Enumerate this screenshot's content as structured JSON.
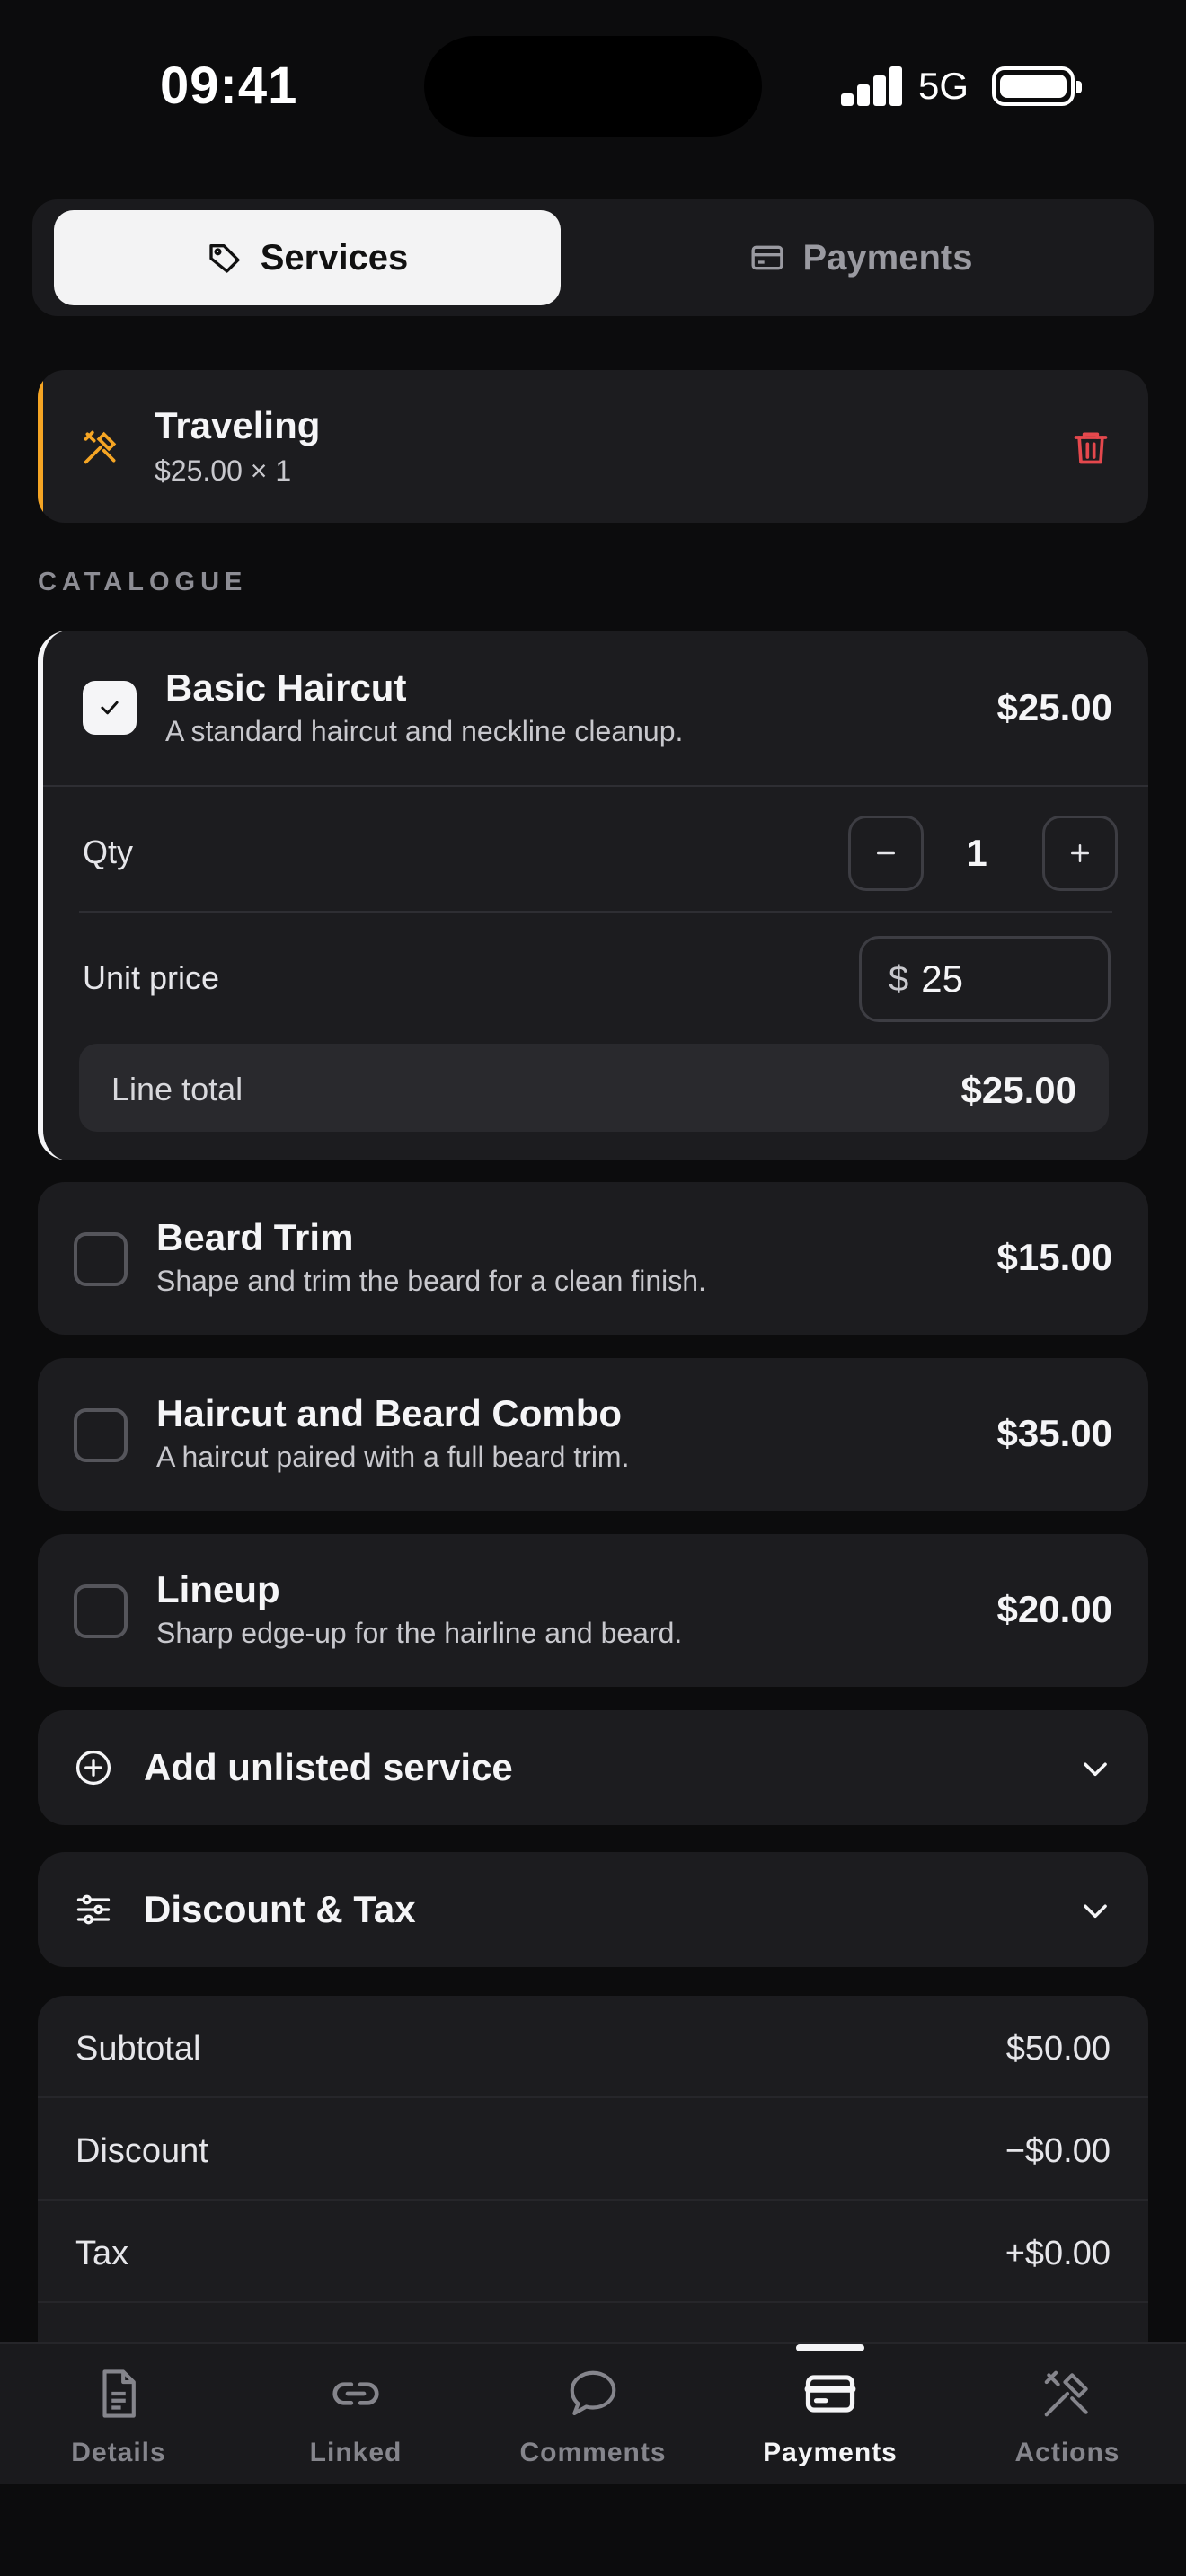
{
  "status_bar": {
    "time": "09:41",
    "network": "5G"
  },
  "segmented": {
    "services_label": "Services",
    "payments_label": "Payments"
  },
  "selected_service": {
    "title": "Traveling",
    "detail": "$25.00 × 1"
  },
  "catalogue": {
    "section_label": "CATALOGUE",
    "expanded_item": {
      "title": "Basic Haircut",
      "description": "A standard haircut and neckline cleanup.",
      "price": "$25.00",
      "checked": true,
      "qty_label": "Qty",
      "qty_value": "1",
      "unit_price_label": "Unit price",
      "currency_symbol": "$",
      "unit_price_value": "25",
      "line_total_label": "Line total",
      "line_total_value": "$25.00"
    },
    "items": [
      {
        "title": "Beard Trim",
        "description": "Shape and trim the beard for a clean finish.",
        "price": "$15.00"
      },
      {
        "title": "Haircut and Beard Combo",
        "description": "A haircut paired with a full beard trim.",
        "price": "$35.00"
      },
      {
        "title": "Lineup",
        "description": "Sharp edge-up for the hairline and beard.",
        "price": "$20.00"
      }
    ]
  },
  "add_unlisted": {
    "label": "Add unlisted service"
  },
  "discount_tax": {
    "label": "Discount & Tax"
  },
  "summary": [
    {
      "label": "Subtotal",
      "value": "$50.00"
    },
    {
      "label": "Discount",
      "value": "−$0.00"
    },
    {
      "label": "Tax",
      "value": "+$0.00"
    }
  ],
  "bottom_nav": [
    {
      "label": "Details",
      "icon": "document-icon"
    },
    {
      "label": "Linked",
      "icon": "link-icon"
    },
    {
      "label": "Comments",
      "icon": "chat-bubble-icon"
    },
    {
      "label": "Payments",
      "icon": "card-icon",
      "active": true
    },
    {
      "label": "Actions",
      "icon": "tools-icon"
    }
  ],
  "colors": {
    "accent": "#f5a524",
    "danger": "#e5484d",
    "background": "#0c0c0d",
    "card": "#1c1c1f"
  }
}
